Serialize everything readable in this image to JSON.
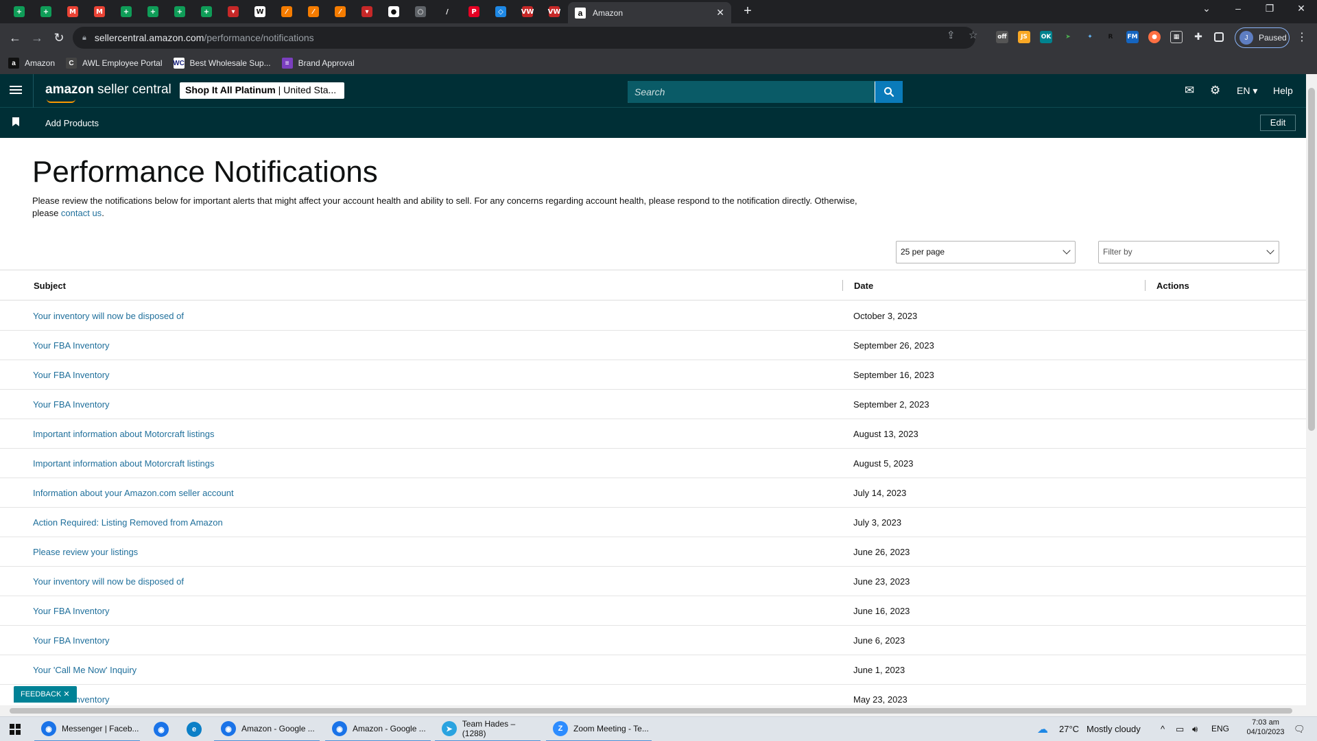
{
  "browser": {
    "active_tab_title": "Amazon",
    "url_host": "sellercentral.amazon.com",
    "url_path": "/performance/notifications",
    "profile_initial": "J",
    "profile_status": "Paused",
    "pinned_tabs": [
      {
        "icon": "sheets-icon",
        "color": "#0f9d58",
        "glyph": "+"
      },
      {
        "icon": "sheets-icon",
        "color": "#0f9d58",
        "glyph": "+"
      },
      {
        "icon": "gmail-icon",
        "color": "#ea4335",
        "glyph": "M"
      },
      {
        "icon": "gmail-icon",
        "color": "#ea4335",
        "glyph": "M"
      },
      {
        "icon": "sheets-icon",
        "color": "#0f9d58",
        "glyph": "+"
      },
      {
        "icon": "sheets-icon",
        "color": "#0f9d58",
        "glyph": "+"
      },
      {
        "icon": "sheets-icon",
        "color": "#0f9d58",
        "glyph": "+"
      },
      {
        "icon": "sheets-icon",
        "color": "#0f9d58",
        "glyph": "+"
      },
      {
        "icon": "tool-icon",
        "color": "#c62828",
        "glyph": "▾"
      },
      {
        "icon": "site-icon",
        "color": "#ffffff",
        "glyph": "W"
      },
      {
        "icon": "tool-icon",
        "color": "#f57c00",
        "glyph": "⁄"
      },
      {
        "icon": "tool-icon",
        "color": "#f57c00",
        "glyph": "⁄"
      },
      {
        "icon": "tool-icon",
        "color": "#f57c00",
        "glyph": "⁄"
      },
      {
        "icon": "tool-icon",
        "color": "#c62828",
        "glyph": "▾"
      },
      {
        "icon": "site-icon",
        "color": "#ffffff",
        "glyph": "●"
      },
      {
        "icon": "site-icon",
        "color": "#5f6368",
        "glyph": "○"
      },
      {
        "icon": "site-icon",
        "color": "#202124",
        "glyph": "/"
      },
      {
        "icon": "pinterest-icon",
        "color": "#e60023",
        "glyph": "P"
      },
      {
        "icon": "site-icon",
        "color": "#1e88e5",
        "glyph": "◇"
      },
      {
        "icon": "site-icon",
        "color": "#c62828",
        "glyph": "VW"
      },
      {
        "icon": "site-icon",
        "color": "#c62828",
        "glyph": "VW"
      }
    ],
    "bookmarks": [
      {
        "label": "Amazon",
        "icon": "amazon-icon",
        "color": "#111111",
        "glyph": "a"
      },
      {
        "label": "AWL Employee Portal",
        "icon": "portal-icon",
        "color": "#444444",
        "glyph": "C"
      },
      {
        "label": "Best Wholesale Sup...",
        "icon": "wholesale-icon",
        "color": "#ffffff",
        "glyph": "WC"
      },
      {
        "label": "Brand Approval",
        "icon": "list-icon",
        "color": "#7b3fbf",
        "glyph": "≡"
      }
    ]
  },
  "header": {
    "logo_bold": "amazon",
    "logo_rest": " seller central",
    "store_name": "Shop It All Platinum",
    "store_region": " | United Sta...",
    "search_placeholder": "Search",
    "language": "EN ▾",
    "help": "Help"
  },
  "subnav": {
    "add_products": "Add Products",
    "edit": "Edit"
  },
  "page": {
    "title": "Performance Notifications",
    "intro": "Please review the notifications below for important alerts that might affect your account health and ability to sell. For any concerns regarding account health, please respond to the notification directly. Otherwise, please ",
    "contact_link": "contact us",
    "intro_end": ".",
    "per_page": "25 per page",
    "filter_placeholder": "Filter by"
  },
  "table": {
    "headers": {
      "subject": "Subject",
      "date": "Date",
      "actions": "Actions"
    },
    "rows": [
      {
        "subject": "Your inventory will now be disposed of",
        "date": "October 3, 2023"
      },
      {
        "subject": "Your FBA Inventory",
        "date": "September 26, 2023"
      },
      {
        "subject": "Your FBA Inventory",
        "date": "September 16, 2023"
      },
      {
        "subject": "Your FBA Inventory",
        "date": "September 2, 2023"
      },
      {
        "subject": "Important information about Motorcraft listings",
        "date": "August 13, 2023"
      },
      {
        "subject": "Important information about Motorcraft listings",
        "date": "August 5, 2023"
      },
      {
        "subject": "Information about your Amazon.com seller account",
        "date": "July 14, 2023"
      },
      {
        "subject": "Action Required: Listing Removed from Amazon",
        "date": "July 3, 2023"
      },
      {
        "subject": "Please review your listings",
        "date": "June 26, 2023"
      },
      {
        "subject": "Your inventory will now be disposed of",
        "date": "June 23, 2023"
      },
      {
        "subject": "Your FBA Inventory",
        "date": "June 16, 2023"
      },
      {
        "subject": "Your FBA Inventory",
        "date": "June 6, 2023"
      },
      {
        "subject": "Your 'Call Me Now' Inquiry",
        "date": "June 1, 2023"
      },
      {
        "subject": "Your FBA Inventory",
        "date": "May 23, 2023"
      }
    ]
  },
  "feedback": "FEEDBACK ✕",
  "taskbar": {
    "apps": [
      {
        "label": "Messenger | Faceb...",
        "color": "#1a73e8",
        "icon": "chrome-icon",
        "open": true
      },
      {
        "label": "",
        "color": "#1a73e8",
        "icon": "chrome-icon",
        "open": false
      },
      {
        "label": "",
        "color": "#0b7fc7",
        "icon": "edge-icon",
        "open": false
      },
      {
        "label": "Amazon - Google ...",
        "color": "#1a73e8",
        "icon": "chrome-icon",
        "open": true
      },
      {
        "label": "Amazon - Google ...",
        "color": "#1a73e8",
        "icon": "chrome-icon",
        "open": true
      },
      {
        "label": "Team Hades – (1288)",
        "color": "#2aa3e0",
        "icon": "telegram-icon",
        "open": true
      },
      {
        "label": "Zoom Meeting - Te...",
        "color": "#2d8cff",
        "icon": "zoom-icon",
        "open": true
      }
    ],
    "weather": "27°C",
    "weather_desc": "Mostly cloudy",
    "lang": "ENG",
    "time": "7:03 am",
    "date": "04/10/2023"
  }
}
